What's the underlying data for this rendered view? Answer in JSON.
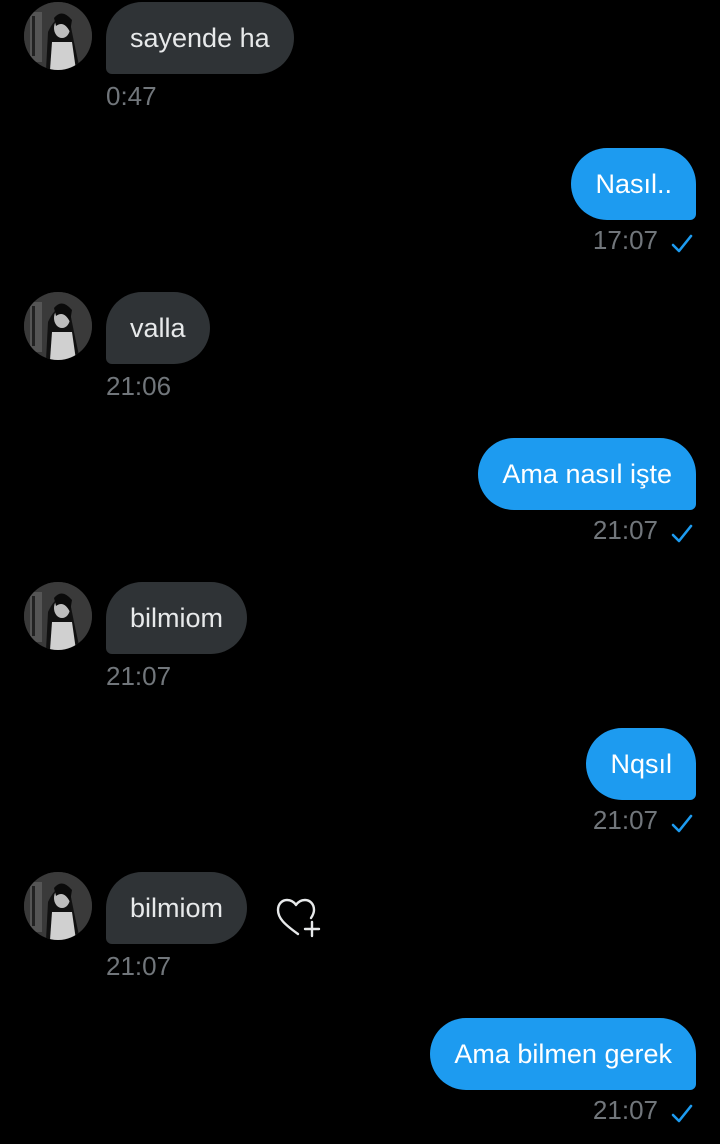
{
  "conversation": {
    "messages": [
      {
        "direction": "incoming",
        "text": "sayende ha",
        "time": "0:47"
      },
      {
        "direction": "outgoing",
        "text": "Nasıl..",
        "time": "17:07",
        "status_icon": "check-icon"
      },
      {
        "direction": "incoming",
        "text": "valla",
        "time": "21:06"
      },
      {
        "direction": "outgoing",
        "text": "Ama nasıl işte",
        "time": "21:07",
        "status_icon": "check-icon"
      },
      {
        "direction": "incoming",
        "text": "bilmiom",
        "time": "21:07"
      },
      {
        "direction": "outgoing",
        "text": "Nqsıl",
        "time": "21:07",
        "status_icon": "check-icon"
      },
      {
        "direction": "incoming",
        "text": "bilmiom",
        "time": "21:07",
        "reaction_icon": "add-reaction-heart-icon"
      },
      {
        "direction": "outgoing",
        "text": "Ama bilmen gerek",
        "time": "21:07",
        "status_icon": "check-icon"
      }
    ]
  },
  "colors": {
    "background": "#000000",
    "incoming_bubble": "#2f3336",
    "outgoing_bubble": "#1d9bf0",
    "timestamp": "#71767b",
    "check": "#1d9bf0"
  }
}
